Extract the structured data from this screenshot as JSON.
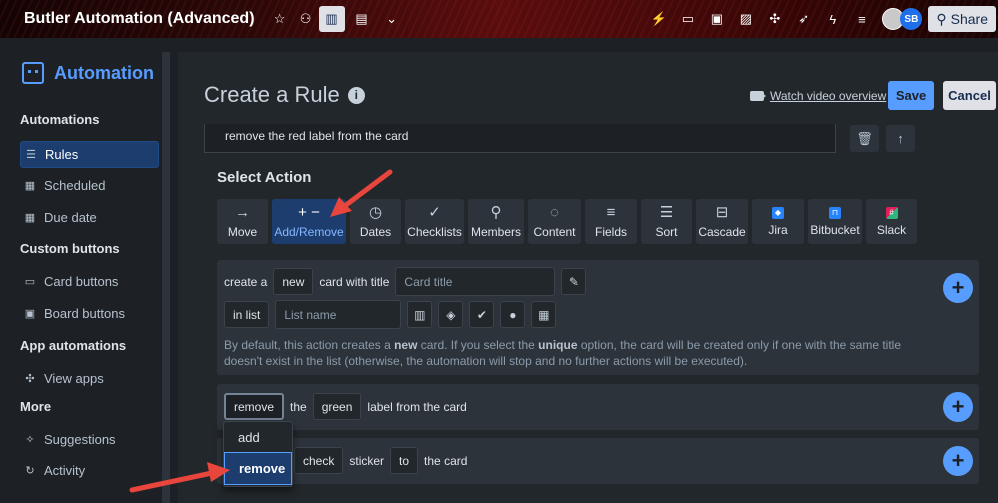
{
  "topbar": {
    "board_title": "Butler Automation (Advanced)",
    "avatar_initials": "SB",
    "share_label": "Share"
  },
  "sidebar": {
    "title": "Automation",
    "sections": {
      "automations": "Automations",
      "custom_buttons": "Custom buttons",
      "app_automations": "App automations",
      "more": "More"
    },
    "items": {
      "rules": "Rules",
      "scheduled": "Scheduled",
      "due_date": "Due date",
      "card_buttons": "Card buttons",
      "board_buttons": "Board buttons",
      "view_apps": "View apps",
      "suggestions": "Suggestions",
      "activity": "Activity"
    }
  },
  "header": {
    "title": "Create a Rule",
    "watch_label": "Watch video overview",
    "save_label": "Save",
    "cancel_label": "Cancel"
  },
  "trigger": {
    "text": "remove the red label from the card"
  },
  "select_action": {
    "heading": "Select Action",
    "tabs": [
      "Move",
      "Add/Remove",
      "Dates",
      "Checklists",
      "Members",
      "Content",
      "Fields",
      "Sort",
      "Cascade",
      "Jira",
      "Bitbucket",
      "Slack"
    ],
    "active_tab": "Add/Remove"
  },
  "create_card": {
    "prefix": "create a",
    "new_chip": "new",
    "with_title": "card with title",
    "title_placeholder": "Card title",
    "in_list": "in list",
    "list_placeholder": "List name",
    "desc_1": "By default, this action creates a ",
    "desc_new": "new",
    "desc_2": " card. If you select the ",
    "desc_unique": "unique",
    "desc_3": " option, the card will be created only if one with the same title doesn't exist in the list (otherwise, the automation will stop and no further actions will be executed)."
  },
  "label_action": {
    "verb": "remove",
    "the": "the",
    "color": "green",
    "suffix": "label from the card"
  },
  "sticker_action": {
    "check": "check",
    "sticker": "sticker",
    "to": "to",
    "suffix": "the card"
  },
  "dropdown": {
    "options": [
      "add",
      "remove"
    ],
    "selected": "remove"
  },
  "colors": {
    "accent": "#579dff",
    "arrow": "#e8453c",
    "active_bg": "#1c3d6e"
  }
}
